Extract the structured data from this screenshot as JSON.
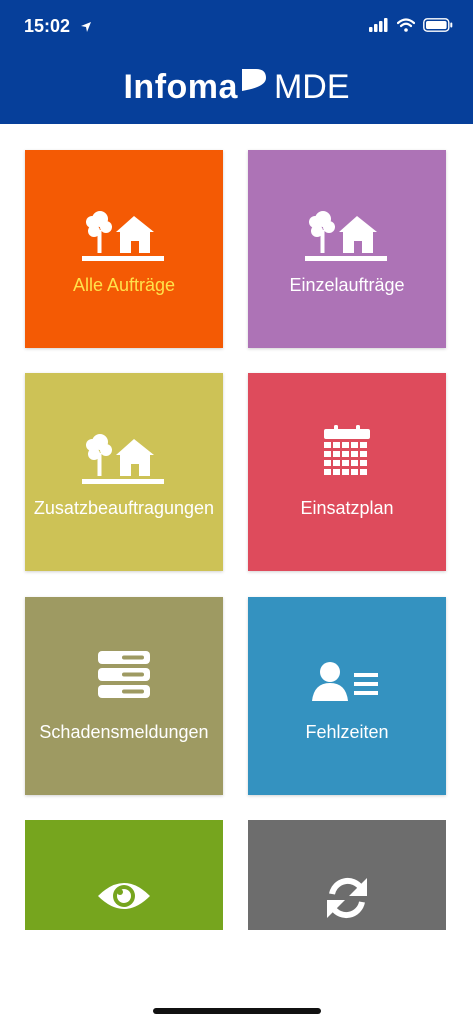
{
  "status": {
    "time": "15:02"
  },
  "header": {
    "brand_name": "Infoma",
    "brand_suffix": "MDE"
  },
  "tiles": [
    {
      "label": "Alle Aufträge",
      "icon": "tree-house-icon",
      "color": "#f45a04",
      "label_color": "#ffe24a"
    },
    {
      "label": "Einzelaufträge",
      "icon": "tree-house-icon",
      "color": "#ad73b6",
      "label_color": "#ffffff"
    },
    {
      "label": "Zusatzbeauftragungen",
      "icon": "tree-house-icon",
      "color": "#cdc256",
      "label_color": "#ffffff"
    },
    {
      "label": "Einsatzplan",
      "icon": "calendar-icon",
      "color": "#de4b5c",
      "label_color": "#ffffff"
    },
    {
      "label": "Schadensmeldungen",
      "icon": "stack-icon",
      "color": "#9e9a62",
      "label_color": "#ffffff"
    },
    {
      "label": "Fehlzeiten",
      "icon": "person-list-icon",
      "color": "#3492c0",
      "label_color": "#ffffff"
    },
    {
      "label": "",
      "icon": "eye-icon",
      "color": "#76a51e",
      "label_color": "#ffffff"
    },
    {
      "label": "",
      "icon": "refresh-icon",
      "color": "#6d6d6d",
      "label_color": "#ffffff"
    }
  ]
}
